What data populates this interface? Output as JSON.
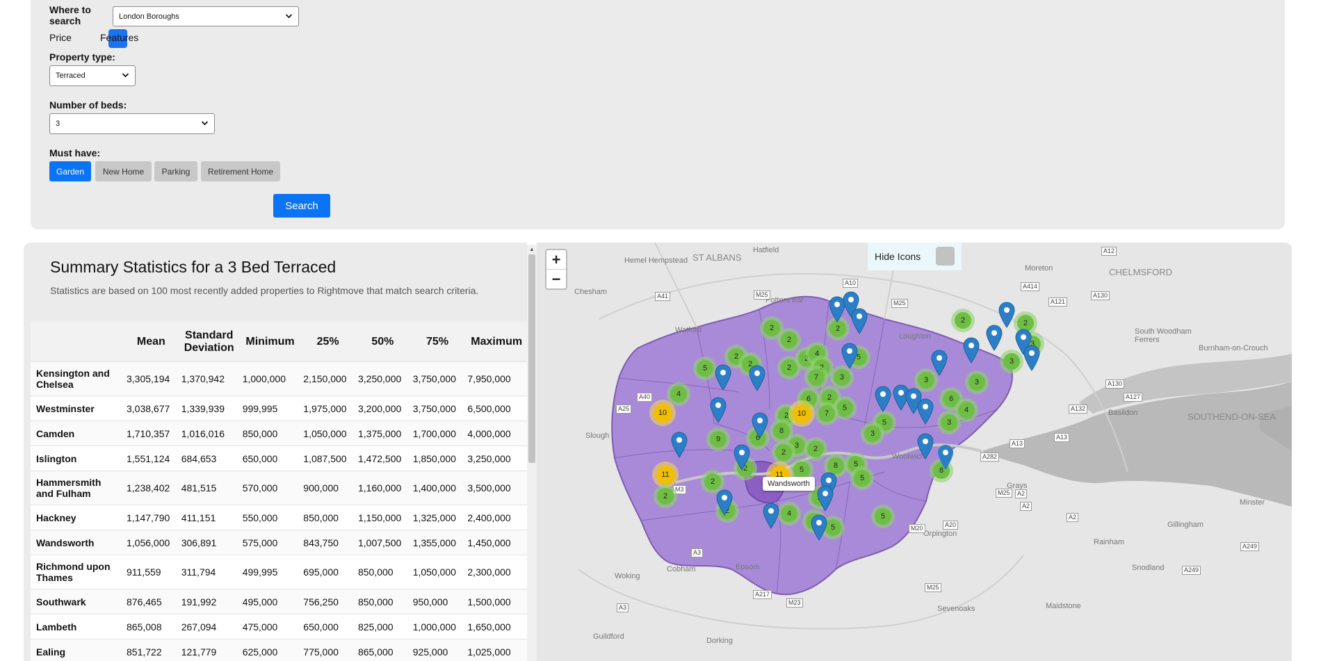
{
  "search": {
    "where_label": "Where to search",
    "where_value": "London Boroughs",
    "price_label": "Price",
    "features_label": "Features",
    "property_type_label": "Property type:",
    "property_type_value": "Terraced",
    "beds_label": "Number of beds:",
    "beds_value": "3",
    "must_have_label": "Must have:",
    "must_have": [
      "Garden",
      "New Home",
      "Parking",
      "Retirement Home"
    ],
    "must_have_active": "Garden",
    "search_button": "Search"
  },
  "stats": {
    "title": "Summary Statistics for a 3 Bed Terraced",
    "subtitle": "Statistics are based on 100 most recently added properties to Rightmove that match search criteria.",
    "columns": [
      "",
      "Mean",
      "Standard Deviation",
      "Minimum",
      "25%",
      "50%",
      "75%",
      "Maximum"
    ],
    "rows": [
      {
        "name": "Kensington and Chelsea",
        "mean": "3,305,194",
        "std": "1,370,942",
        "min": "1,000,000",
        "p25": "2,150,000",
        "p50": "3,250,000",
        "p75": "3,750,000",
        "max": "7,950,000"
      },
      {
        "name": "Westminster",
        "mean": "3,038,677",
        "std": "1,339,939",
        "min": "999,995",
        "p25": "1,975,000",
        "p50": "3,200,000",
        "p75": "3,750,000",
        "max": "6,500,000"
      },
      {
        "name": "Camden",
        "mean": "1,710,357",
        "std": "1,016,016",
        "min": "850,000",
        "p25": "1,050,000",
        "p50": "1,375,000",
        "p75": "1,700,000",
        "max": "4,000,000"
      },
      {
        "name": "Islington",
        "mean": "1,551,124",
        "std": "684,653",
        "min": "650,000",
        "p25": "1,087,500",
        "p50": "1,472,500",
        "p75": "1,850,000",
        "max": "3,250,000"
      },
      {
        "name": "Hammersmith and Fulham",
        "mean": "1,238,402",
        "std": "481,515",
        "min": "570,000",
        "p25": "900,000",
        "p50": "1,160,000",
        "p75": "1,400,000",
        "max": "3,500,000"
      },
      {
        "name": "Hackney",
        "mean": "1,147,790",
        "std": "411,151",
        "min": "550,000",
        "p25": "850,000",
        "p50": "1,150,000",
        "p75": "1,325,000",
        "max": "2,400,000"
      },
      {
        "name": "Wandsworth",
        "mean": "1,056,000",
        "std": "306,891",
        "min": "575,000",
        "p25": "843,750",
        "p50": "1,007,500",
        "p75": "1,355,000",
        "max": "1,450,000"
      },
      {
        "name": "Richmond upon Thames",
        "mean": "911,559",
        "std": "311,794",
        "min": "499,995",
        "p25": "695,000",
        "p50": "850,000",
        "p75": "1,050,000",
        "max": "2,300,000"
      },
      {
        "name": "Southwark",
        "mean": "876,465",
        "std": "191,992",
        "min": "495,000",
        "p25": "756,250",
        "p50": "850,000",
        "p75": "950,000",
        "max": "1,500,000"
      },
      {
        "name": "Lambeth",
        "mean": "865,008",
        "std": "267,094",
        "min": "475,000",
        "p25": "650,000",
        "p50": "825,000",
        "p75": "1,000,000",
        "max": "1,650,000"
      },
      {
        "name": "Ealing",
        "mean": "851,722",
        "std": "121,779",
        "min": "625,000",
        "p25": "775,000",
        "p50": "865,000",
        "p75": "925,000",
        "max": "1,025,000"
      }
    ]
  },
  "map": {
    "zoom_in": "+",
    "zoom_out": "−",
    "hide_icons_label": "Hide Icons",
    "tooltip": "Wandsworth",
    "places": [
      "Hemel Hempstead",
      "ST ALBANS",
      "Hatfield",
      "CHELMSFORD",
      "Moreton",
      "Chesham",
      "Potters Bar",
      "Watford",
      "Loughton",
      "South Woodham Ferrers",
      "Burnham-on-Crouch",
      "Basildon",
      "SOUTHEND-ON-SEA",
      "Slough",
      "Grays",
      "Woolwich",
      "Orpington",
      "Epsom",
      "Cobham",
      "Woking",
      "Sevenoaks",
      "Maidstone",
      "Dorking",
      "Guildford",
      "Rainham",
      "Snodland",
      "Minster",
      "Gillingham",
      "Chipping"
    ],
    "roads": [
      "A12",
      "A130",
      "A414",
      "A10",
      "M25",
      "A41",
      "A121",
      "A1(M)",
      "A127",
      "A132",
      "A13",
      "A282",
      "A2",
      "M20",
      "A20",
      "A249",
      "M3",
      "A3",
      "A217",
      "M23",
      "A40",
      "A25"
    ],
    "clusters": [
      "2",
      "2",
      "2",
      "2",
      "5",
      "2",
      "2",
      "4",
      "2",
      "5",
      "2",
      "2",
      "3",
      "4",
      "7",
      "10",
      "2",
      "3",
      "5",
      "7",
      "6",
      "2",
      "10",
      "8",
      "9",
      "6",
      "3",
      "2",
      "2",
      "5",
      "3",
      "11",
      "5",
      "8",
      "2",
      "5",
      "2",
      "11",
      "2",
      "2",
      "2",
      "5",
      "4",
      "4",
      "5",
      "5",
      "3",
      "3",
      "6",
      "4",
      "8",
      "3",
      "2",
      "3"
    ],
    "colors": {
      "borough_fill": "#a98ad8",
      "cluster_green": "#6fbe44",
      "cluster_yellow": "#f0c000",
      "pin_blue": "#2c7fc7"
    }
  }
}
